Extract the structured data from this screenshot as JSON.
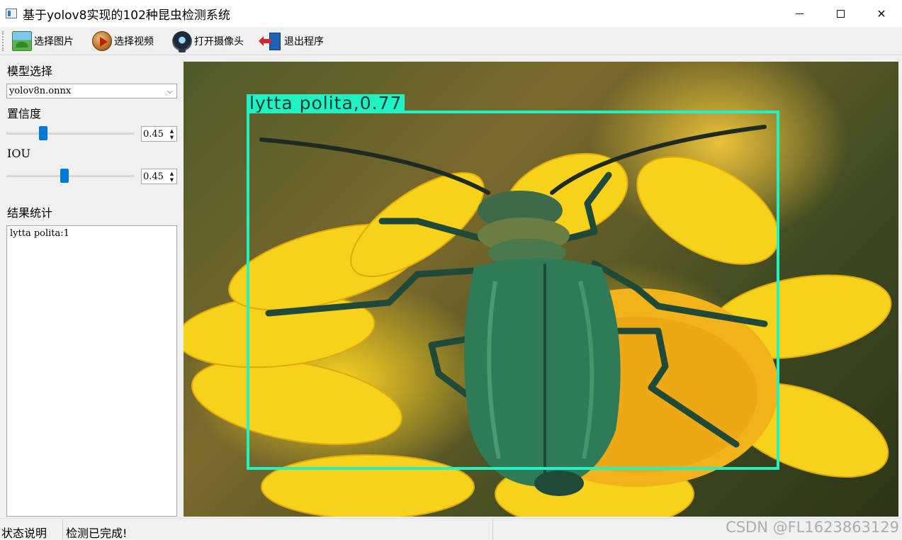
{
  "window": {
    "title": "基于yolov8实现的102种昆虫检测系统"
  },
  "toolbar": {
    "items": [
      {
        "label": "选择图片",
        "icon": "image-icon"
      },
      {
        "label": "选择视频",
        "icon": "video-play-icon"
      },
      {
        "label": "打开摄像头",
        "icon": "webcam-icon"
      },
      {
        "label": "退出程序",
        "icon": "exit-door-icon"
      }
    ]
  },
  "panel": {
    "model_label": "模型选择",
    "model_value": "yolov8n.onnx",
    "confidence_label": "置信度",
    "confidence_value": "0.45",
    "confidence_slider_fraction": 0.27,
    "iou_label": "IOU",
    "iou_value": "0.45",
    "iou_slider_fraction": 0.45,
    "results_label": "结果统计",
    "results_text": "lytta polita:1"
  },
  "detection": {
    "label": "lytta polita,0.77",
    "box_color": "#21f2c4"
  },
  "status": {
    "title": "状态说明",
    "message": "检测已完成!",
    "watermark": "CSDN @FL1623863129"
  }
}
